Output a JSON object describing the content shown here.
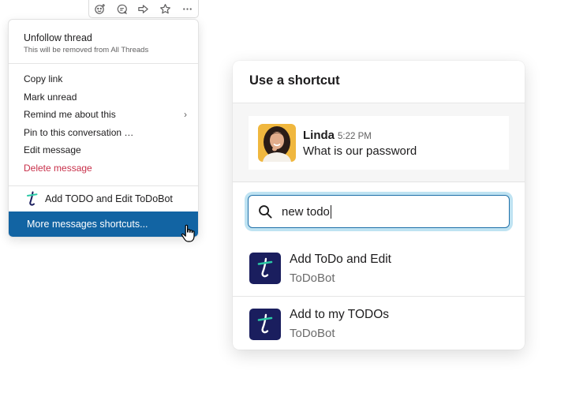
{
  "toolbar": {
    "icons": [
      "add-reaction-icon",
      "reply-thread-icon",
      "share-arrow-icon",
      "star-icon",
      "more-actions-icon"
    ]
  },
  "menu": {
    "unfollow": {
      "label": "Unfollow thread",
      "sub": "This will be removed from All Threads"
    },
    "items": [
      {
        "label": "Copy link"
      },
      {
        "label": "Mark unread"
      },
      {
        "label": "Remind me about this",
        "chevron": "›"
      },
      {
        "label": "Pin to this conversation …"
      },
      {
        "label": "Edit message"
      },
      {
        "label": "Delete message"
      }
    ],
    "todo_label": "Add TODO and Edit ToDoBot",
    "more_label": "More messages shortcuts..."
  },
  "panel": {
    "title": "Use a shortcut",
    "message": {
      "name": "Linda",
      "time": "5:22 PM",
      "text": "What is our password"
    },
    "search": {
      "value": "new todo"
    },
    "results": [
      {
        "title": "Add ToDo and Edit",
        "sub": "ToDoBot"
      },
      {
        "title": "Add to my TODOs",
        "sub": "ToDoBot"
      }
    ]
  },
  "colors": {
    "selected_menu_bg": "#1264a3",
    "danger": "#c8304a",
    "todobot_icon_bg": "#1a1e5e",
    "todobot_accent": "#2bc9a6",
    "search_focus": "#bfe3f2"
  }
}
